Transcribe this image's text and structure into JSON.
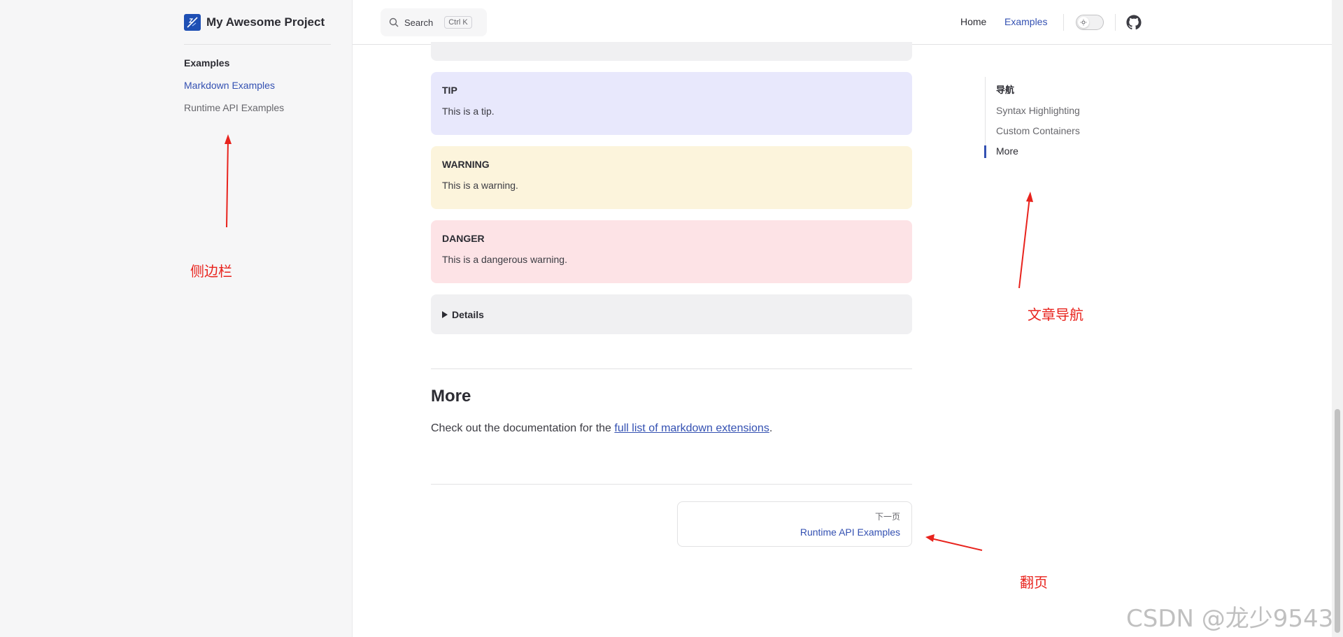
{
  "sidebar": {
    "brand": "My Awesome Project",
    "section_heading": "Examples",
    "items": [
      {
        "label": "Markdown Examples",
        "active": true
      },
      {
        "label": "Runtime API Examples",
        "active": false
      }
    ]
  },
  "navbar": {
    "search_label": "Search",
    "search_shortcut": "Ctrl K",
    "links": [
      {
        "label": "Home",
        "active": false
      },
      {
        "label": "Examples",
        "active": true
      }
    ],
    "icons": [
      "search-icon",
      "sun-icon",
      "github-icon"
    ]
  },
  "content": {
    "callouts": {
      "tip": {
        "title": "TIP",
        "body": "This is a tip."
      },
      "warning": {
        "title": "WARNING",
        "body": "This is a warning."
      },
      "danger": {
        "title": "DANGER",
        "body": "This is a dangerous warning."
      }
    },
    "details_label": "Details",
    "more_section": {
      "title": "More",
      "text_before": "Check out the documentation for the ",
      "link_text": "full list of markdown extensions",
      "text_after": "."
    }
  },
  "pager": {
    "next_desc": "下一页",
    "next_title": "Runtime API Examples"
  },
  "outline": {
    "title": "导航",
    "items": [
      {
        "label": "Syntax Highlighting",
        "active": false
      },
      {
        "label": "Custom Containers",
        "active": false
      },
      {
        "label": "More",
        "active": true
      }
    ]
  },
  "annotations": {
    "sidebar": "侧边栏",
    "outline": "文章导航",
    "pager": "翻页"
  },
  "watermark": "CSDN @龙少9543",
  "colors": {
    "brand": "#3451b2",
    "tip_bg": "#e8e8fc",
    "warning_bg": "#fcf4dc",
    "danger_bg": "#fde3e6",
    "annotation": "#e8231d"
  }
}
